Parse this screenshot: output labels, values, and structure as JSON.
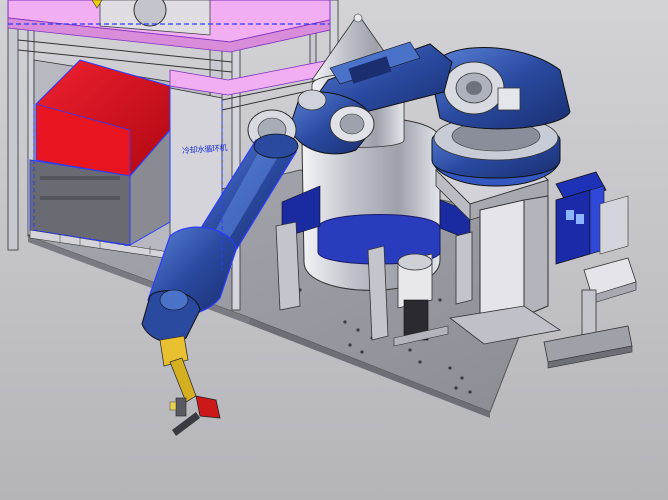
{
  "scene": {
    "cabinet_label": "冷却水循环机",
    "colors": {
      "background_top": "#cfcfd4",
      "background_bottom": "#b6b6bb",
      "robot_blue": "#2a4aa0",
      "robot_blue_light": "#4a72c8",
      "frame_magenta": "#f0a8f0",
      "cabinet_red": "#d8101a",
      "base_plate": "#9a9aa2",
      "tank_silver": "#c8cad2",
      "highlight_blue": "#2a3cff"
    },
    "icons": [
      "warning-triangle-icon"
    ]
  }
}
